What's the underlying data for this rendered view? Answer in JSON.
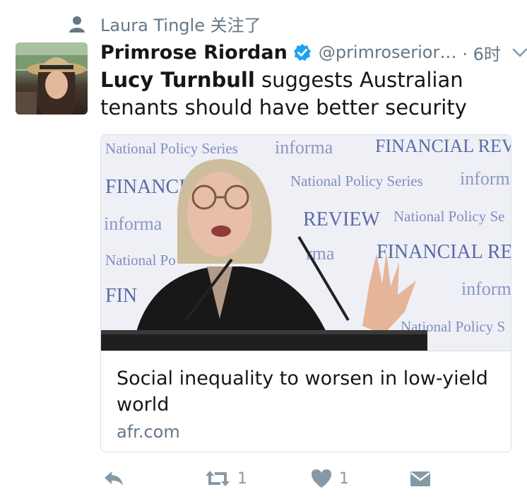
{
  "context": {
    "icon": "person-icon",
    "text": "Laura Tingle 关注了"
  },
  "tweet": {
    "author_name": "Primrose Riordan",
    "verified_icon": "verified-badge-icon",
    "handle": "@primroserior…",
    "time": "· 6时",
    "menu_icon": "chevron-down-icon",
    "text_bold": "Lucy Turnbull",
    "text_rest": " suggests Australian tenants should have better security",
    "card": {
      "title": "Social inequality to worsen in low-yield world",
      "domain": "afr.com",
      "backdrop_words": [
        "National Policy Series",
        "informa",
        "FINANCIAL REVIEW",
        "FINANCIAL",
        "National Policy Series",
        "informa",
        "informa",
        "REVIEW",
        "National Policy Se",
        "National Po",
        "rma",
        "FINANCIAL REVI",
        "FIN",
        "informa",
        "National Policy S"
      ]
    },
    "actions": {
      "reply_icon": "reply-icon",
      "retweet_icon": "retweet-icon",
      "retweet_count": "1",
      "like_icon": "heart-icon",
      "like_count": "1",
      "dm_icon": "envelope-icon"
    }
  },
  "colors": {
    "text": "#14171a",
    "muted": "#657786",
    "accent": "#1da1f2",
    "border": "#d8dde2"
  }
}
